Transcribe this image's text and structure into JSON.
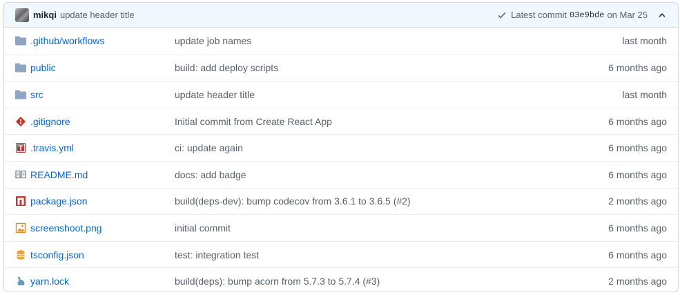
{
  "header": {
    "author": "mikqi",
    "message": "update header title",
    "latest_label": "Latest commit",
    "sha": "03e9bde",
    "date": "on Mar 25"
  },
  "files": [
    {
      "icon": "folder-icon",
      "name_prefix": ".github/",
      "name": "workflows",
      "message": "update job names",
      "age": "last month"
    },
    {
      "icon": "folder-icon",
      "name_prefix": "",
      "name": "public",
      "message": "build: add deploy scripts",
      "age": "6 months ago"
    },
    {
      "icon": "folder-icon",
      "name_prefix": "",
      "name": "src",
      "message": "update header title",
      "age": "last month"
    },
    {
      "icon": "git-icon",
      "name_prefix": "",
      "name": ".gitignore",
      "message": "Initial commit from Create React App",
      "age": "6 months ago"
    },
    {
      "icon": "travis-icon",
      "name_prefix": "",
      "name": ".travis.yml",
      "message": "ci: update again",
      "age": "6 months ago"
    },
    {
      "icon": "book-icon",
      "name_prefix": "",
      "name": "README.md",
      "message": "docs: add badge",
      "age": "6 months ago"
    },
    {
      "icon": "npm-icon",
      "name_prefix": "",
      "name": "package.json",
      "message": "build(deps-dev): bump codecov from 3.6.1 to 3.6.5 (#2)",
      "age": "2 months ago"
    },
    {
      "icon": "image-icon",
      "name_prefix": "",
      "name": "screenshoot.png",
      "message": "initial commit",
      "age": "6 months ago"
    },
    {
      "icon": "database-icon",
      "name_prefix": "",
      "name": "tsconfig.json",
      "message": "test: integration test",
      "age": "6 months ago"
    },
    {
      "icon": "yarn-icon",
      "name_prefix": "",
      "name": "yarn.lock",
      "message": "build(deps): bump acorn from 5.7.3 to 5.7.4 (#3)",
      "age": "2 months ago"
    }
  ]
}
